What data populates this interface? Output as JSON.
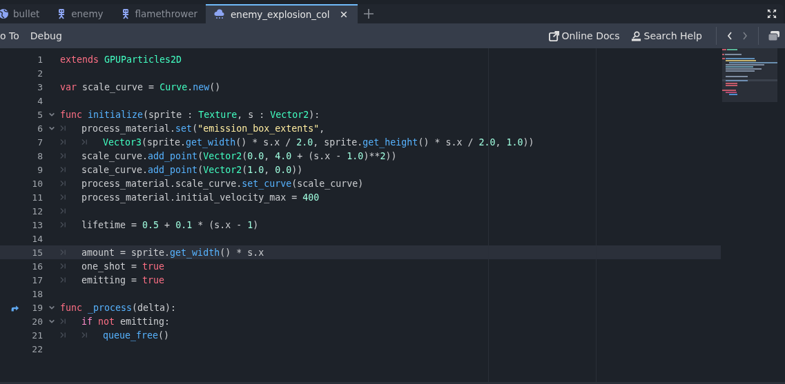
{
  "tabs": [
    {
      "label": "bullet",
      "kind": "globe",
      "selected": false
    },
    {
      "label": "enemy",
      "kind": "figure",
      "selected": false
    },
    {
      "label": "flamethrower",
      "kind": "figure",
      "selected": false
    },
    {
      "label": "enemy_explosion_col",
      "kind": "cloud",
      "selected": true
    }
  ],
  "menu": [
    "o To",
    "Debug"
  ],
  "help_links": [
    "Online Docs",
    "Search Help"
  ],
  "code": [
    {
      "number": "1",
      "tokens": [
        {
          "kind": "kw",
          "text": "extends "
        },
        {
          "kind": "type",
          "text": "GPUParticles2D"
        }
      ]
    },
    {
      "number": "2"
    },
    {
      "number": "3",
      "tokens": [
        {
          "kind": "kw",
          "text": "var"
        },
        {
          "kind": "plain",
          "text": " scale_curve = "
        },
        {
          "kind": "type",
          "text": "Curve"
        },
        {
          "kind": "plain",
          "text": "."
        },
        {
          "kind": "fn",
          "text": "new"
        },
        {
          "kind": "plain",
          "text": "()"
        }
      ]
    },
    {
      "number": "4"
    },
    {
      "number": "5",
      "foldable": true,
      "tokens": [
        {
          "kind": "kw",
          "text": "func "
        },
        {
          "kind": "fn",
          "text": "initialize"
        },
        {
          "kind": "plain",
          "text": "(sprite : "
        },
        {
          "kind": "type",
          "text": "Texture"
        },
        {
          "kind": "plain",
          "text": ", s : "
        },
        {
          "kind": "type",
          "text": "Vector2"
        },
        {
          "kind": "plain",
          "text": "):"
        }
      ]
    },
    {
      "number": "6",
      "foldable": true,
      "tokens": [
        {
          "kind": "tab"
        },
        {
          "kind": "plain",
          "text": "process_material."
        },
        {
          "kind": "fn",
          "text": "set"
        },
        {
          "kind": "plain",
          "text": "("
        },
        {
          "kind": "str",
          "text": "\"emission_box_extents\""
        },
        {
          "kind": "plain",
          "text": ","
        }
      ]
    },
    {
      "number": "7",
      "tokens": [
        {
          "kind": "tab"
        },
        {
          "kind": "tab"
        },
        {
          "kind": "type",
          "text": "Vector3"
        },
        {
          "kind": "plain",
          "text": "(sprite."
        },
        {
          "kind": "fn",
          "text": "get_width"
        },
        {
          "kind": "plain",
          "text": "() * s.x / "
        },
        {
          "kind": "num",
          "text": "2.0"
        },
        {
          "kind": "plain",
          "text": ", sprite."
        },
        {
          "kind": "fn",
          "text": "get_height"
        },
        {
          "kind": "plain",
          "text": "() * s.x / "
        },
        {
          "kind": "num",
          "text": "2.0"
        },
        {
          "kind": "plain",
          "text": ", "
        },
        {
          "kind": "num",
          "text": "1.0"
        },
        {
          "kind": "plain",
          "text": "))"
        }
      ]
    },
    {
      "number": "8",
      "tokens": [
        {
          "kind": "tab"
        },
        {
          "kind": "plain",
          "text": "scale_curve."
        },
        {
          "kind": "fn",
          "text": "add_point"
        },
        {
          "kind": "plain",
          "text": "("
        },
        {
          "kind": "type",
          "text": "Vector2"
        },
        {
          "kind": "plain",
          "text": "("
        },
        {
          "kind": "num",
          "text": "0.0"
        },
        {
          "kind": "plain",
          "text": ", "
        },
        {
          "kind": "num",
          "text": "4.0"
        },
        {
          "kind": "plain",
          "text": " + (s.x - "
        },
        {
          "kind": "num",
          "text": "1.0"
        },
        {
          "kind": "plain",
          "text": ")**"
        },
        {
          "kind": "num",
          "text": "2"
        },
        {
          "kind": "plain",
          "text": "))"
        }
      ]
    },
    {
      "number": "9",
      "tokens": [
        {
          "kind": "tab"
        },
        {
          "kind": "plain",
          "text": "scale_curve."
        },
        {
          "kind": "fn",
          "text": "add_point"
        },
        {
          "kind": "plain",
          "text": "("
        },
        {
          "kind": "type",
          "text": "Vector2"
        },
        {
          "kind": "plain",
          "text": "("
        },
        {
          "kind": "num",
          "text": "1.0"
        },
        {
          "kind": "plain",
          "text": ", "
        },
        {
          "kind": "num",
          "text": "0.0"
        },
        {
          "kind": "plain",
          "text": "))"
        }
      ]
    },
    {
      "number": "10",
      "tokens": [
        {
          "kind": "tab"
        },
        {
          "kind": "plain",
          "text": "process_material.scale_curve."
        },
        {
          "kind": "fn",
          "text": "set_curve"
        },
        {
          "kind": "plain",
          "text": "(scale_curve)"
        }
      ]
    },
    {
      "number": "11",
      "tokens": [
        {
          "kind": "tab"
        },
        {
          "kind": "plain",
          "text": "process_material.initial_velocity_max = "
        },
        {
          "kind": "num",
          "text": "400"
        }
      ]
    },
    {
      "number": "12",
      "tokens": [
        {
          "kind": "tab"
        }
      ]
    },
    {
      "number": "13",
      "tokens": [
        {
          "kind": "tab"
        },
        {
          "kind": "plain",
          "text": "lifetime = "
        },
        {
          "kind": "num",
          "text": "0.5"
        },
        {
          "kind": "plain",
          "text": " + "
        },
        {
          "kind": "num",
          "text": "0.1"
        },
        {
          "kind": "plain",
          "text": " * (s.x - "
        },
        {
          "kind": "num",
          "text": "1"
        },
        {
          "kind": "plain",
          "text": ")"
        }
      ]
    },
    {
      "number": "14"
    },
    {
      "number": "15",
      "current": true,
      "tokens": [
        {
          "kind": "tab"
        },
        {
          "kind": "plain",
          "text": "amount = sprite."
        },
        {
          "kind": "fn",
          "text": "get_width"
        },
        {
          "kind": "plain",
          "text": "() * s.x"
        }
      ]
    },
    {
      "number": "16",
      "tokens": [
        {
          "kind": "tab"
        },
        {
          "kind": "plain",
          "text": "one_shot = "
        },
        {
          "kind": "kw",
          "text": "true"
        }
      ]
    },
    {
      "number": "17",
      "tokens": [
        {
          "kind": "tab"
        },
        {
          "kind": "plain",
          "text": "emitting = "
        },
        {
          "kind": "kw",
          "text": "true"
        }
      ]
    },
    {
      "number": "18"
    },
    {
      "number": "19",
      "foldable": true,
      "override": true,
      "tokens": [
        {
          "kind": "kw",
          "text": "func "
        },
        {
          "kind": "fn",
          "text": "_process"
        },
        {
          "kind": "plain",
          "text": "(delta):"
        }
      ]
    },
    {
      "number": "20",
      "foldable": true,
      "tokens": [
        {
          "kind": "tab"
        },
        {
          "kind": "ctrl",
          "text": "if "
        },
        {
          "kind": "kw",
          "text": "not"
        },
        {
          "kind": "plain",
          "text": " emitting:"
        }
      ]
    },
    {
      "number": "21",
      "tokens": [
        {
          "kind": "tab"
        },
        {
          "kind": "tab"
        },
        {
          "kind": "fn",
          "text": "queue_free"
        },
        {
          "kind": "plain",
          "text": "()"
        }
      ]
    },
    {
      "number": "22"
    }
  ]
}
